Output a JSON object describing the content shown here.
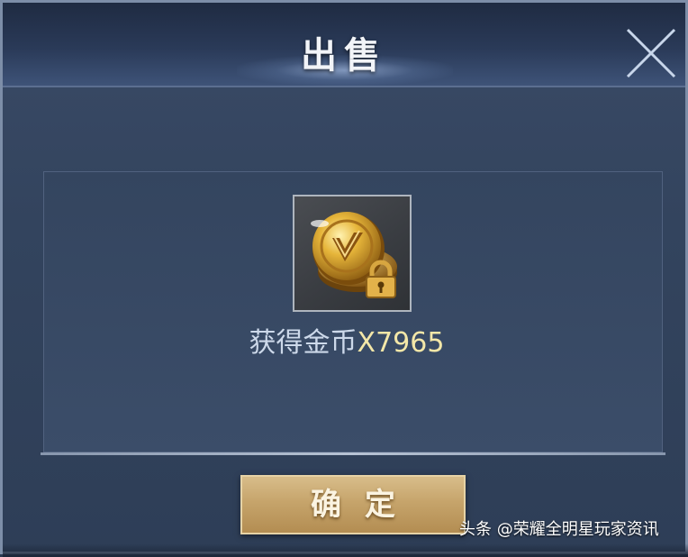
{
  "dialog": {
    "title": "出售",
    "close_icon": "close-x-icon"
  },
  "reward": {
    "item_icon": "gold-coin-locked-icon",
    "label": "获得金币",
    "amount": "X7965"
  },
  "actions": {
    "confirm_label": "确定"
  },
  "watermark": {
    "text": "头条 @荣耀全明星玩家资讯"
  },
  "colors": {
    "panel": "#34455f",
    "header": "#2a3a58",
    "button_gold": "#c6a46b",
    "amount_text": "#f3e7a8"
  }
}
